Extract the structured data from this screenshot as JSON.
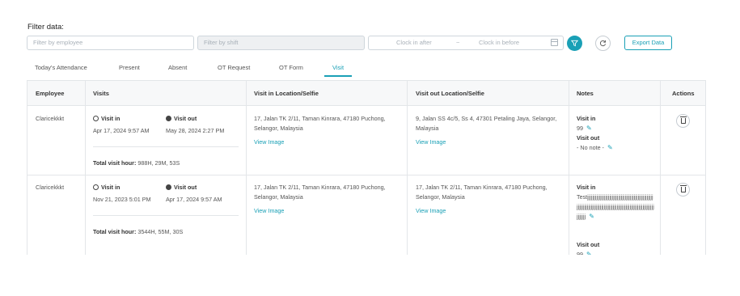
{
  "filter": {
    "title": "Filter data:",
    "employee_placeholder": "Filter by employee",
    "shift_placeholder": "Filter by shift",
    "clock_in_after": "Clock in after",
    "clock_in_before": "Clock in before",
    "range_separator": "~",
    "export_label": "Export Data"
  },
  "tabs": [
    {
      "label": "Today's Attendance"
    },
    {
      "label": "Present"
    },
    {
      "label": "Absent"
    },
    {
      "label": "OT Request"
    },
    {
      "label": "OT Form"
    },
    {
      "label": "Visit",
      "active": true
    }
  ],
  "table": {
    "headers": [
      "Employee",
      "Visits",
      "Visit in Location/Selfie",
      "Visit out Location/Selfie",
      "Notes",
      "Actions"
    ],
    "rows": [
      {
        "employee": "Claricekkkt",
        "visit_in_label": "Visit in",
        "visit_in_time": "Apr 17, 2024 9:57 AM",
        "visit_out_label": "Visit out",
        "visit_out_time": "May 28, 2024 2:27 PM",
        "total_label": "Total visit hour:",
        "total_value": "988H, 29M, 53S",
        "in_location": "17, Jalan TK 2/11, Taman Kinrara, 47180 Puchong, Selangor, Malaysia",
        "in_link": "View Image",
        "out_location": "9, Jalan SS 4c/5, Ss 4, 47301 Petaling Jaya, Selangor, Malaysia",
        "out_link": "View Image",
        "notes_in_label": "Visit in",
        "notes_in_value": "99",
        "notes_out_label": "Visit out",
        "notes_out_value": "- No note -"
      },
      {
        "employee": "Claricekkkt",
        "visit_in_label": "Visit in",
        "visit_in_time": "Nov 21, 2023 5:01 PM",
        "visit_out_label": "Visit out",
        "visit_out_time": "Apr 17, 2024 9:57 AM",
        "total_label": "Total visit hour:",
        "total_value": "3544H, 55M, 30S",
        "in_location": "17, Jalan TK 2/11, Taman Kinrara, 47180 Puchong, Selangor, Malaysia",
        "in_link": "View Image",
        "out_location": "17, Jalan TK 2/11, Taman Kinrara, 47180 Puchong, Selangor, Malaysia",
        "out_link": "View Image",
        "notes_in_label": "Visit in",
        "notes_in_value": "Testjjjjjjjjjjjjjjjjjjjjjjjjjjjjjjjjjjjjjjjjjjjjjjjjjjjjjjjjjjjjjjjjjjjjjjjjjjjjjjjjjjjjjjjjjjjjjjjjjjjjjjjjjjjjjjjjjjjjjj",
        "notes_out_label": "Visit out",
        "notes_out_value": "99"
      }
    ]
  },
  "colors": {
    "accent": "#1aa0b6",
    "border": "#e3e6e9",
    "header_bg": "#f7f8f9"
  }
}
